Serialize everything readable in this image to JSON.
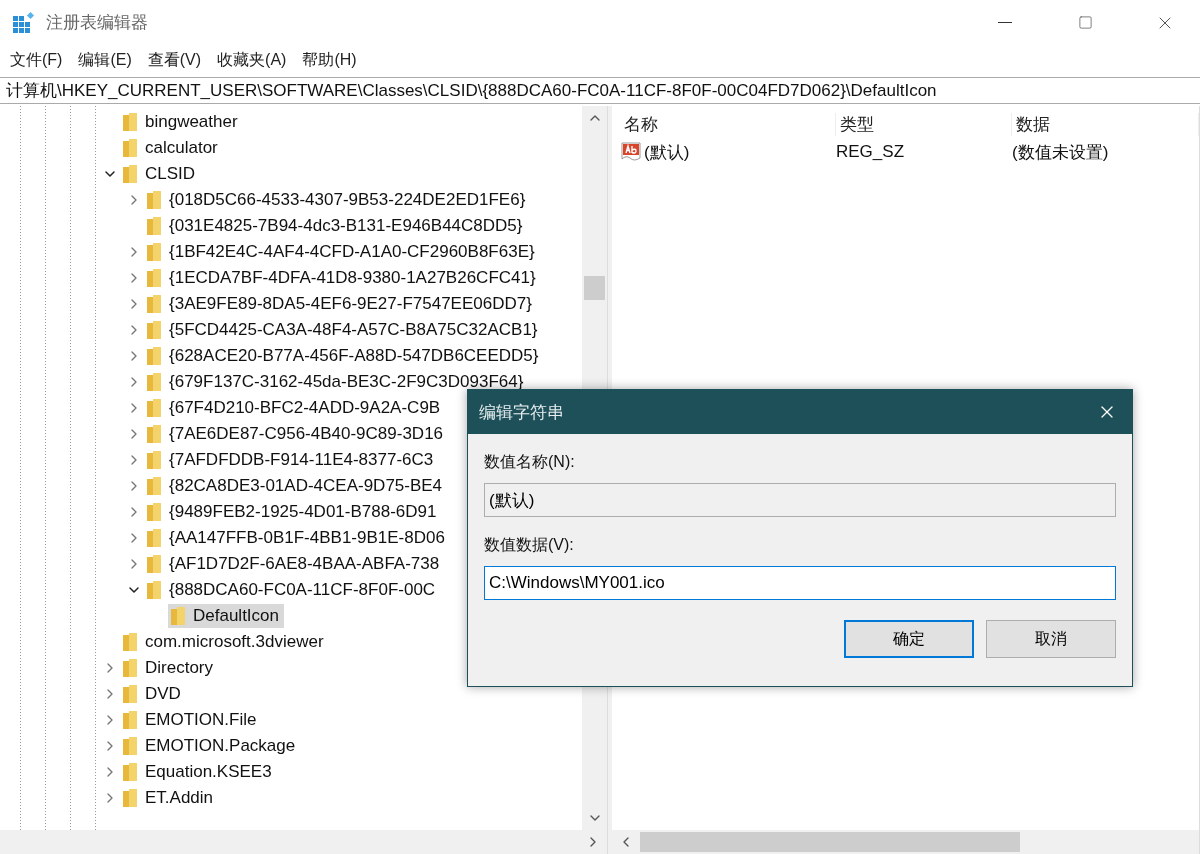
{
  "window": {
    "title": "注册表编辑器"
  },
  "menu": [
    "文件(F)",
    "编辑(E)",
    "查看(V)",
    "收藏夹(A)",
    "帮助(H)"
  ],
  "address": "计算机\\HKEY_CURRENT_USER\\SOFTWARE\\Classes\\CLSID\\{888DCA60-FC0A-11CF-8F0F-00C04FD7D062}\\DefaultIcon",
  "tree": [
    {
      "label": "bingweather",
      "expandable": false,
      "selected": false
    },
    {
      "label": "calculator",
      "expandable": false,
      "selected": false
    },
    {
      "label": "CLSID",
      "expandable": true,
      "expanded": true,
      "selected": false,
      "children": [
        {
          "label": "{018D5C66-4533-4307-9B53-224DE2ED1FE6}",
          "expandable": true,
          "expanded": false,
          "selected": false
        },
        {
          "label": "{031E4825-7B94-4dc3-B131-E946B44C8DD5}",
          "expandable": false,
          "selected": false
        },
        {
          "label": "{1BF42E4C-4AF4-4CFD-A1A0-CF2960B8F63E}",
          "expandable": true,
          "expanded": false,
          "selected": false
        },
        {
          "label": "{1ECDA7BF-4DFA-41D8-9380-1A27B26CFC41}",
          "expandable": true,
          "expanded": false,
          "selected": false
        },
        {
          "label": "{3AE9FE89-8DA5-4EF6-9E27-F7547EE06DD7}",
          "expandable": true,
          "expanded": false,
          "selected": false
        },
        {
          "label": "{5FCD4425-CA3A-48F4-A57C-B8A75C32ACB1}",
          "expandable": true,
          "expanded": false,
          "selected": false
        },
        {
          "label": "{628ACE20-B77A-456F-A88D-547DB6CEEDD5}",
          "expandable": true,
          "expanded": false,
          "selected": false
        },
        {
          "label": "{679F137C-3162-45da-BE3C-2F9C3D093F64}",
          "expandable": true,
          "expanded": false,
          "selected": false
        },
        {
          "label": "{67F4D210-BFC2-4ADD-9A2A-C9B",
          "expandable": true,
          "expanded": false,
          "selected": false
        },
        {
          "label": "{7AE6DE87-C956-4B40-9C89-3D16",
          "expandable": true,
          "expanded": false,
          "selected": false
        },
        {
          "label": "{7AFDFDDB-F914-11E4-8377-6C3",
          "expandable": true,
          "expanded": false,
          "selected": false
        },
        {
          "label": "{82CA8DE3-01AD-4CEA-9D75-BE4",
          "expandable": true,
          "expanded": false,
          "selected": false
        },
        {
          "label": "{9489FEB2-1925-4D01-B788-6D91",
          "expandable": true,
          "expanded": false,
          "selected": false
        },
        {
          "label": "{AA147FFB-0B1F-4BB1-9B1E-8D06",
          "expandable": true,
          "expanded": false,
          "selected": false
        },
        {
          "label": "{AF1D7D2F-6AE8-4BAA-ABFA-738",
          "expandable": true,
          "expanded": false,
          "selected": false
        },
        {
          "label": "{888DCA60-FC0A-11CF-8F0F-00C",
          "expandable": true,
          "expanded": true,
          "selected": false,
          "children": [
            {
              "label": "DefaultIcon",
              "expandable": false,
              "selected": true
            }
          ]
        }
      ]
    },
    {
      "label": "com.microsoft.3dviewer",
      "expandable": false,
      "selected": false
    },
    {
      "label": "Directory",
      "expandable": true,
      "expanded": false,
      "selected": false
    },
    {
      "label": "DVD",
      "expandable": true,
      "expanded": false,
      "selected": false
    },
    {
      "label": "EMOTION.File",
      "expandable": true,
      "expanded": false,
      "selected": false
    },
    {
      "label": "EMOTION.Package",
      "expandable": true,
      "expanded": false,
      "selected": false
    },
    {
      "label": "Equation.KSEE3",
      "expandable": true,
      "expanded": false,
      "selected": false
    },
    {
      "label": "ET.Addin",
      "expandable": true,
      "expanded": false,
      "selected": false
    }
  ],
  "values": {
    "columns": [
      "名称",
      "类型",
      "数据"
    ],
    "rows": [
      {
        "name": "(默认)",
        "type": "REG_SZ",
        "data": "(数值未设置)"
      }
    ]
  },
  "dialog": {
    "title": "编辑字符串",
    "name_label": "数值名称(N):",
    "name_value": "(默认)",
    "data_label": "数值数据(V):",
    "data_value": "C:\\Windows\\MY001.ico",
    "buttons": [
      {
        "label": "确定",
        "default": true
      },
      {
        "label": "取消",
        "default": false
      }
    ]
  }
}
